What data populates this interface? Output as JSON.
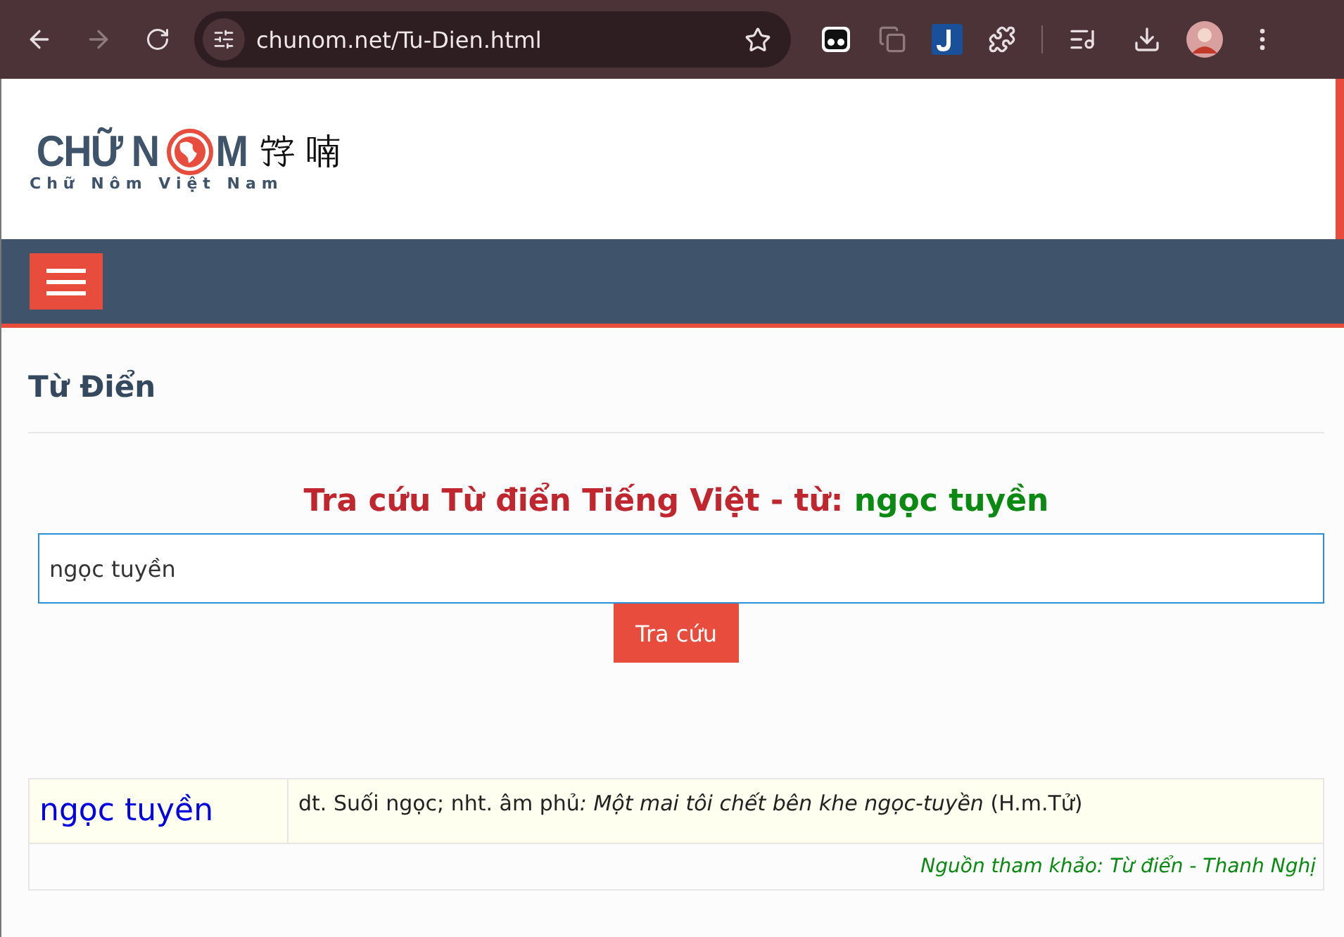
{
  "browser": {
    "url": "chunom.net/Tu-Dien.html",
    "forward_disabled": true
  },
  "logo": {
    "title_start": "CHỮ N",
    "title_end": "M",
    "han": [
      "𡨸",
      "喃"
    ],
    "subtitle": "Chữ Nôm Việt Nam"
  },
  "page_title": "Từ Điển",
  "search": {
    "heading": "Tra cứu Từ điển Tiếng Việt - từ: ",
    "query_word": "ngọc tuyền",
    "value": "ngọc tuyền",
    "button": "Tra cứu"
  },
  "results": [
    {
      "word": "ngọc tuyền",
      "definition": "dt. Suối ngọc; nht. âm phủ",
      "example": ": Một mai tôi chết bên khe ngọc-tuyền",
      "reference": "(H.m.Tử)",
      "source": "Nguồn tham khảo: Từ điển - Thanh Nghị"
    }
  ]
}
